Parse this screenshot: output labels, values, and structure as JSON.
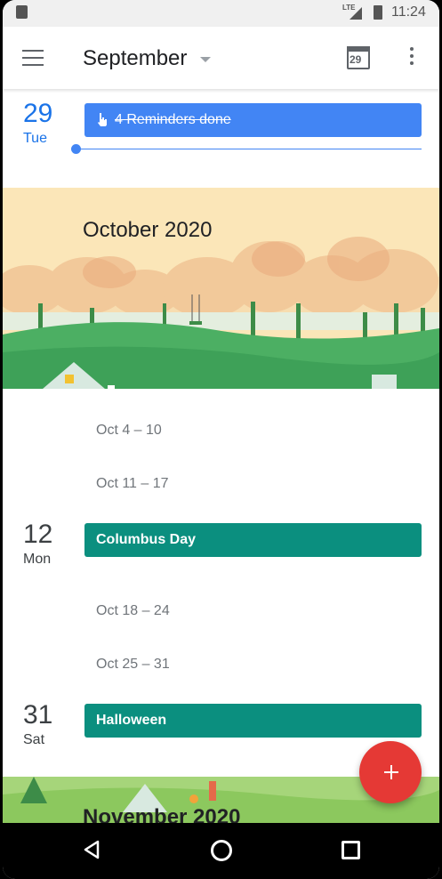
{
  "status_bar": {
    "network": "LTE",
    "time": "11:24"
  },
  "app_bar": {
    "menu_icon": "hamburger-menu-icon",
    "title": "September",
    "today_icon_date": "29",
    "more_icon": "more-vert-icon"
  },
  "schedule": {
    "day_sep29": {
      "day_num": "29",
      "day_name": "Tue",
      "event_label": "4 Reminders done"
    },
    "october_banner": {
      "label": "October 2020"
    },
    "week_oct4": "Oct 4 – 10",
    "week_oct11": "Oct 11 – 17",
    "day_oct12": {
      "day_num": "12",
      "day_name": "Mon",
      "event_label": "Columbus Day"
    },
    "week_oct18": "Oct 18 – 24",
    "week_oct25": "Oct 25 – 31",
    "day_oct31": {
      "day_num": "31",
      "day_name": "Sat",
      "event_label": "Halloween"
    },
    "november_banner": {
      "label": "November 2020"
    }
  },
  "fab": {
    "icon": "plus-icon"
  },
  "colors": {
    "accent_blue": "#1a73e8",
    "reminder_blue": "#4285f4",
    "event_teal": "#0b8f7f",
    "fab_red": "#e53935"
  }
}
